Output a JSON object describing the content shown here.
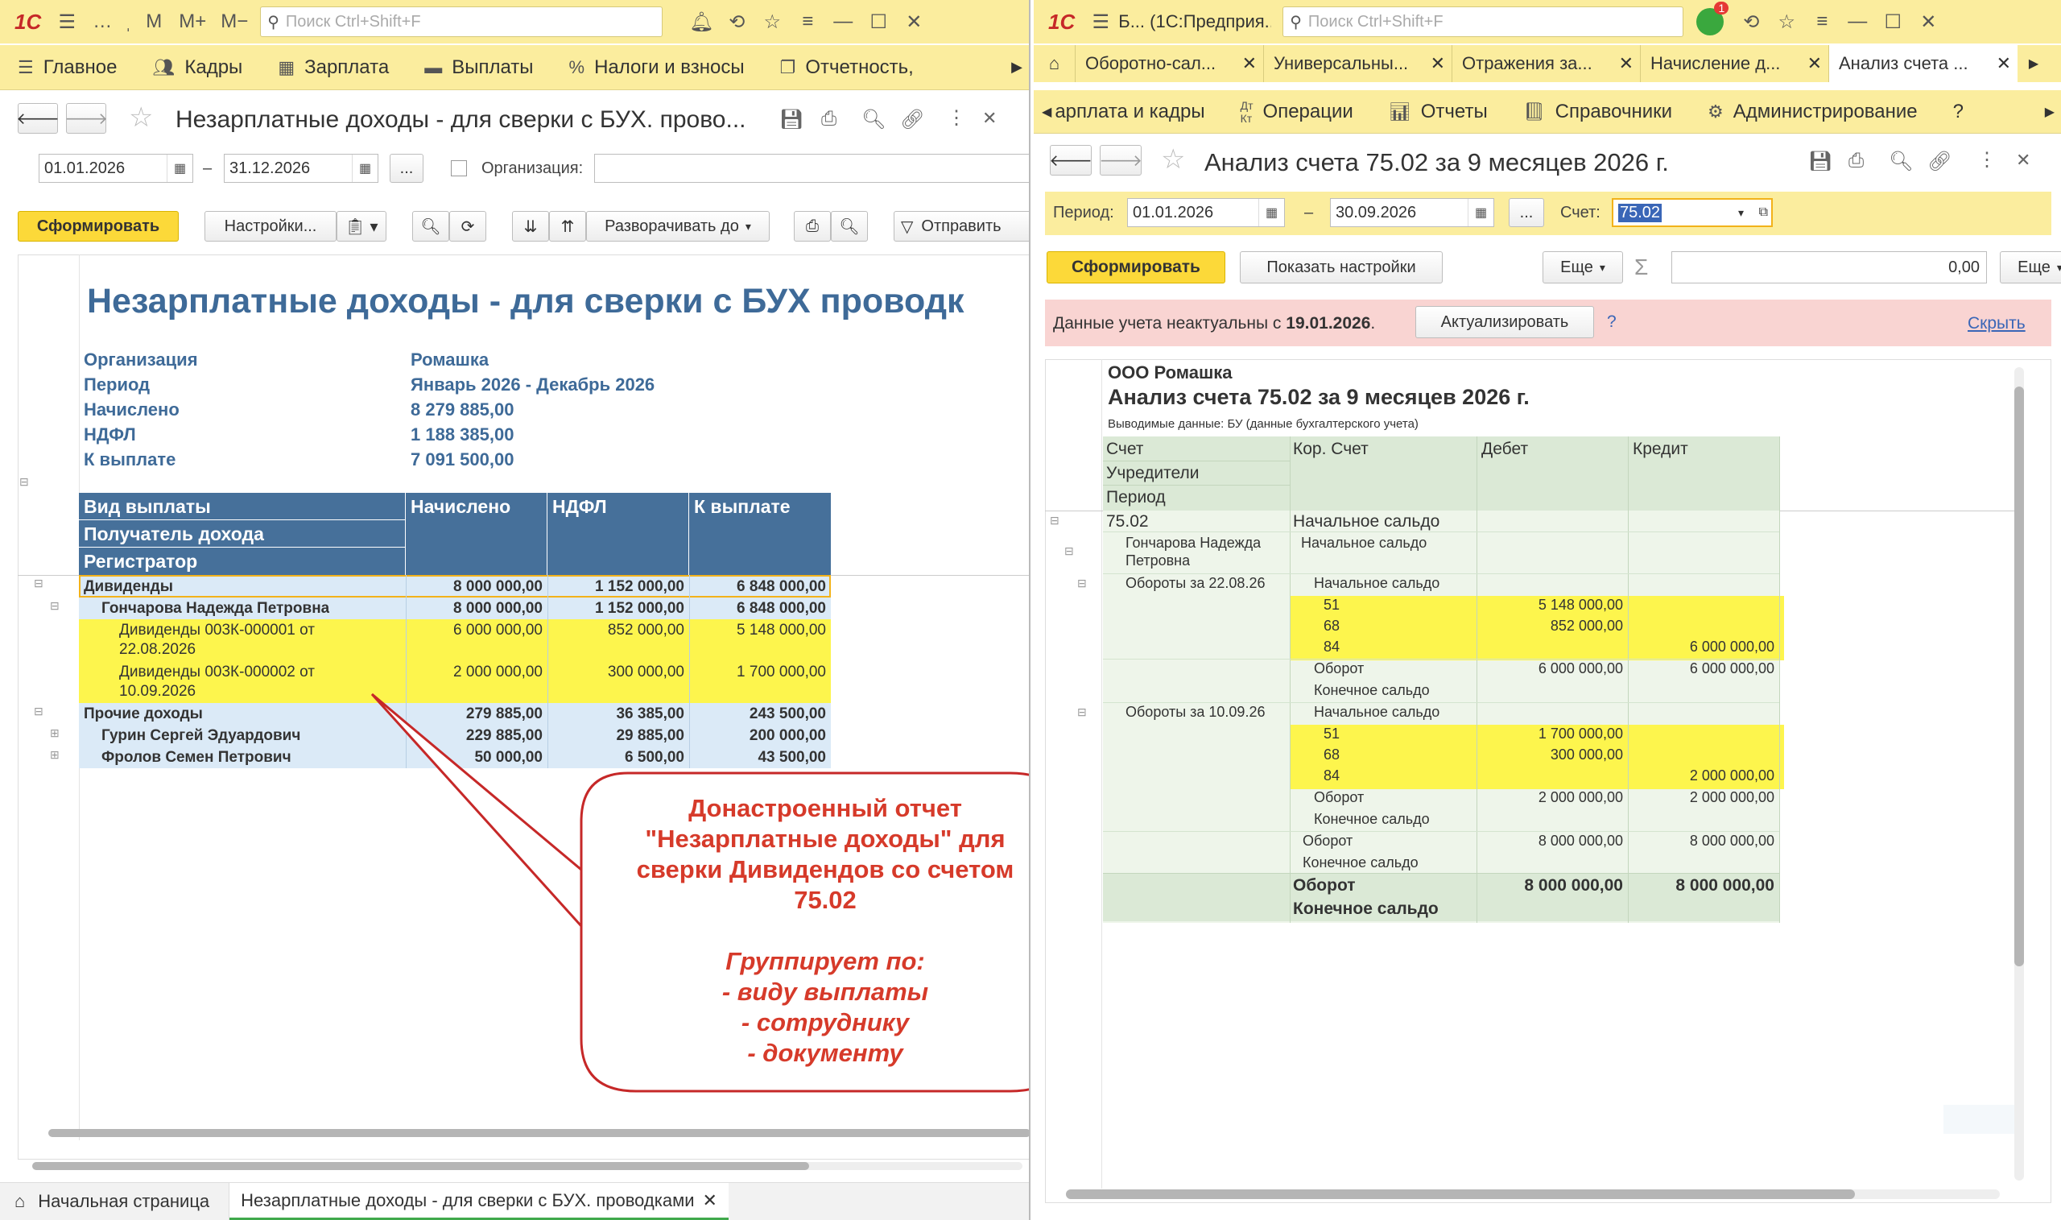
{
  "left": {
    "titlebar": {
      "search_placeholder": "Поиск Ctrl+Shift+F"
    },
    "menu": [
      "Главное",
      "Кадры",
      "Зарплата",
      "Выплаты",
      "Налоги и взносы",
      "Отчетность, "
    ],
    "page_title": "Незарплатные доходы - для сверки с БУХ. прово...",
    "period_from": "01.01.2026",
    "period_to": "31.12.2026",
    "dash": "–",
    "ellipsis": "...",
    "org_label": "Организация:",
    "toolbar": {
      "generate": "Сформировать",
      "settings": "Настройки...",
      "expand": "Разворачивать до",
      "send": "Отправить"
    },
    "report": {
      "title": "Незарплатные доходы - для сверки с БУХ проводк",
      "params": [
        {
          "label": "Организация",
          "value": "Ромашка"
        },
        {
          "label": "Период",
          "value": "Январь 2026 - Декабрь 2026"
        },
        {
          "label": "Начислено",
          "value": "8 279 885,00"
        },
        {
          "label": "НДФЛ",
          "value": "1 188 385,00"
        },
        {
          "label": "К выплате",
          "value": "7 091 500,00"
        }
      ],
      "headers": {
        "group1": "Вид выплаты",
        "group2": "Получатель дохода",
        "group3": "Регистратор",
        "col1": "Начислено",
        "col2": "НДФЛ",
        "col3": "К выплате"
      },
      "rows": [
        {
          "name": "Дивиденды",
          "c1": "8 000 000,00",
          "c2": "1 152 000,00",
          "c3": "6 848 000,00"
        },
        {
          "name": "Гончарова Надежда Петровна",
          "c1": "8 000 000,00",
          "c2": "1 152 000,00",
          "c3": "6 848 000,00"
        },
        {
          "name": "Дивиденды 003К-000001 от",
          "name2": "22.08.2026",
          "c1": "6 000 000,00",
          "c2": "852 000,00",
          "c3": "5 148 000,00"
        },
        {
          "name": "Дивиденды 003К-000002 от",
          "name2": "10.09.2026",
          "c1": "2 000 000,00",
          "c2": "300 000,00",
          "c3": "1 700 000,00"
        },
        {
          "name": "Прочие доходы",
          "c1": "279 885,00",
          "c2": "36 385,00",
          "c3": "243 500,00"
        },
        {
          "name": "Гурин Сергей Эдуардович",
          "c1": "229 885,00",
          "c2": "29 885,00",
          "c3": "200 000,00"
        },
        {
          "name": "Фролов Семен Петрович",
          "c1": "50 000,00",
          "c2": "6 500,00",
          "c3": "43 500,00"
        }
      ]
    },
    "callout": {
      "line1": "Донастроенный отчет",
      "line2": "\"Незарплатные доходы\" для",
      "line3": "сверки Дивидендов со счетом",
      "line4": "75.02",
      "line5": "Группирует по:",
      "line6": "- виду выплаты",
      "line7": "- сотруднику",
      "line8": "- документу"
    },
    "bottom_tabs": [
      "Начальная страница",
      "Незарплатные доходы - для сверки с БУХ. проводками"
    ]
  },
  "right": {
    "titlebar": {
      "app_title": "Б... (1С:Предприя...",
      "search_placeholder": "Поиск Ctrl+Shift+F",
      "badge": "1"
    },
    "tabs": [
      "Оборотно-сал...",
      "Универсальны...",
      "Отражения за...",
      "Начисление д...",
      "Анализ счета ..."
    ],
    "menu": [
      "арплата и кадры",
      "Операции",
      "Отчеты",
      "Справочники",
      "Администрирование",
      "?"
    ],
    "page_title": "Анализ счета 75.02 за 9 месяцев 2026 г.",
    "period_label": "Период:",
    "period_from": "01.01.2026",
    "period_to": "30.09.2026",
    "dash": "–",
    "ellipsis": "...",
    "account_label": "Счет:",
    "account_value": "75.02",
    "toolbar": {
      "generate": "Сформировать",
      "show_settings": "Показать настройки",
      "more": "Еще",
      "sum": "0,00",
      "more2": "Еще"
    },
    "warning": {
      "text": "Данные учета неактуальны с ",
      "date": "19.01.2026",
      "dot": ".",
      "button": "Актуализировать",
      "q": "?",
      "hide": "Скрыть"
    },
    "report": {
      "org": "ООО Ромашка",
      "title": "Анализ счета 75.02 за 9 месяцев 2026 г.",
      "subtitle": "Выводимые данные:  БУ (данные бухгалтерского учета)",
      "headers": {
        "h1": "Счет",
        "h2": "Учредители",
        "h3": "Период",
        "kor": "Кор. Счет",
        "debit": "Дебет",
        "credit": "Кредит"
      },
      "rows": [
        {
          "a": "75.02",
          "k": "Начальное сальдо",
          "d": "",
          "c": ""
        },
        {
          "a": "Гончарова Надежда",
          "a2": "Петровна",
          "k": "Начальное сальдо",
          "d": "",
          "c": ""
        },
        {
          "a": "Обороты за 22.08.26",
          "k": "Начальное сальдо",
          "d": "",
          "c": ""
        },
        {
          "a": "",
          "k": "51",
          "d": "5 148 000,00",
          "c": ""
        },
        {
          "a": "",
          "k": "68",
          "d": "852 000,00",
          "c": ""
        },
        {
          "a": "",
          "k": "84",
          "d": "",
          "c": "6 000 000,00"
        },
        {
          "a": "",
          "k": "Оборот",
          "d": "6 000 000,00",
          "c": "6 000 000,00"
        },
        {
          "a": "",
          "k": "Конечное сальдо",
          "d": "",
          "c": ""
        },
        {
          "a": "Обороты за 10.09.26",
          "k": "Начальное сальдо",
          "d": "",
          "c": ""
        },
        {
          "a": "",
          "k": "51",
          "d": "1 700 000,00",
          "c": ""
        },
        {
          "a": "",
          "k": "68",
          "d": "300 000,00",
          "c": ""
        },
        {
          "a": "",
          "k": "84",
          "d": "",
          "c": "2 000 000,00"
        },
        {
          "a": "",
          "k": "Оборот",
          "d": "2 000 000,00",
          "c": "2 000 000,00"
        },
        {
          "a": "",
          "k": "Конечное сальдо",
          "d": "",
          "c": ""
        },
        {
          "a": "",
          "k": "Оборот",
          "d": "8 000 000,00",
          "c": "8 000 000,00"
        },
        {
          "a": "",
          "k": "Конечное сальдо",
          "d": "",
          "c": ""
        },
        {
          "a": "",
          "k": "Оборот",
          "d": "8 000 000,00",
          "c": "8 000 000,00"
        },
        {
          "a": "",
          "k": "Конечное сальдо",
          "d": "",
          "c": ""
        }
      ]
    }
  },
  "colors": {
    "yellow_bar": "#fbed9e",
    "header_blue": "#46709a",
    "row_blue": "#dbeaf7",
    "highlight": "#fdf54d",
    "green": "#dbe9d6",
    "callout_text": "#d63a2a",
    "callout_border": "#c62828"
  }
}
